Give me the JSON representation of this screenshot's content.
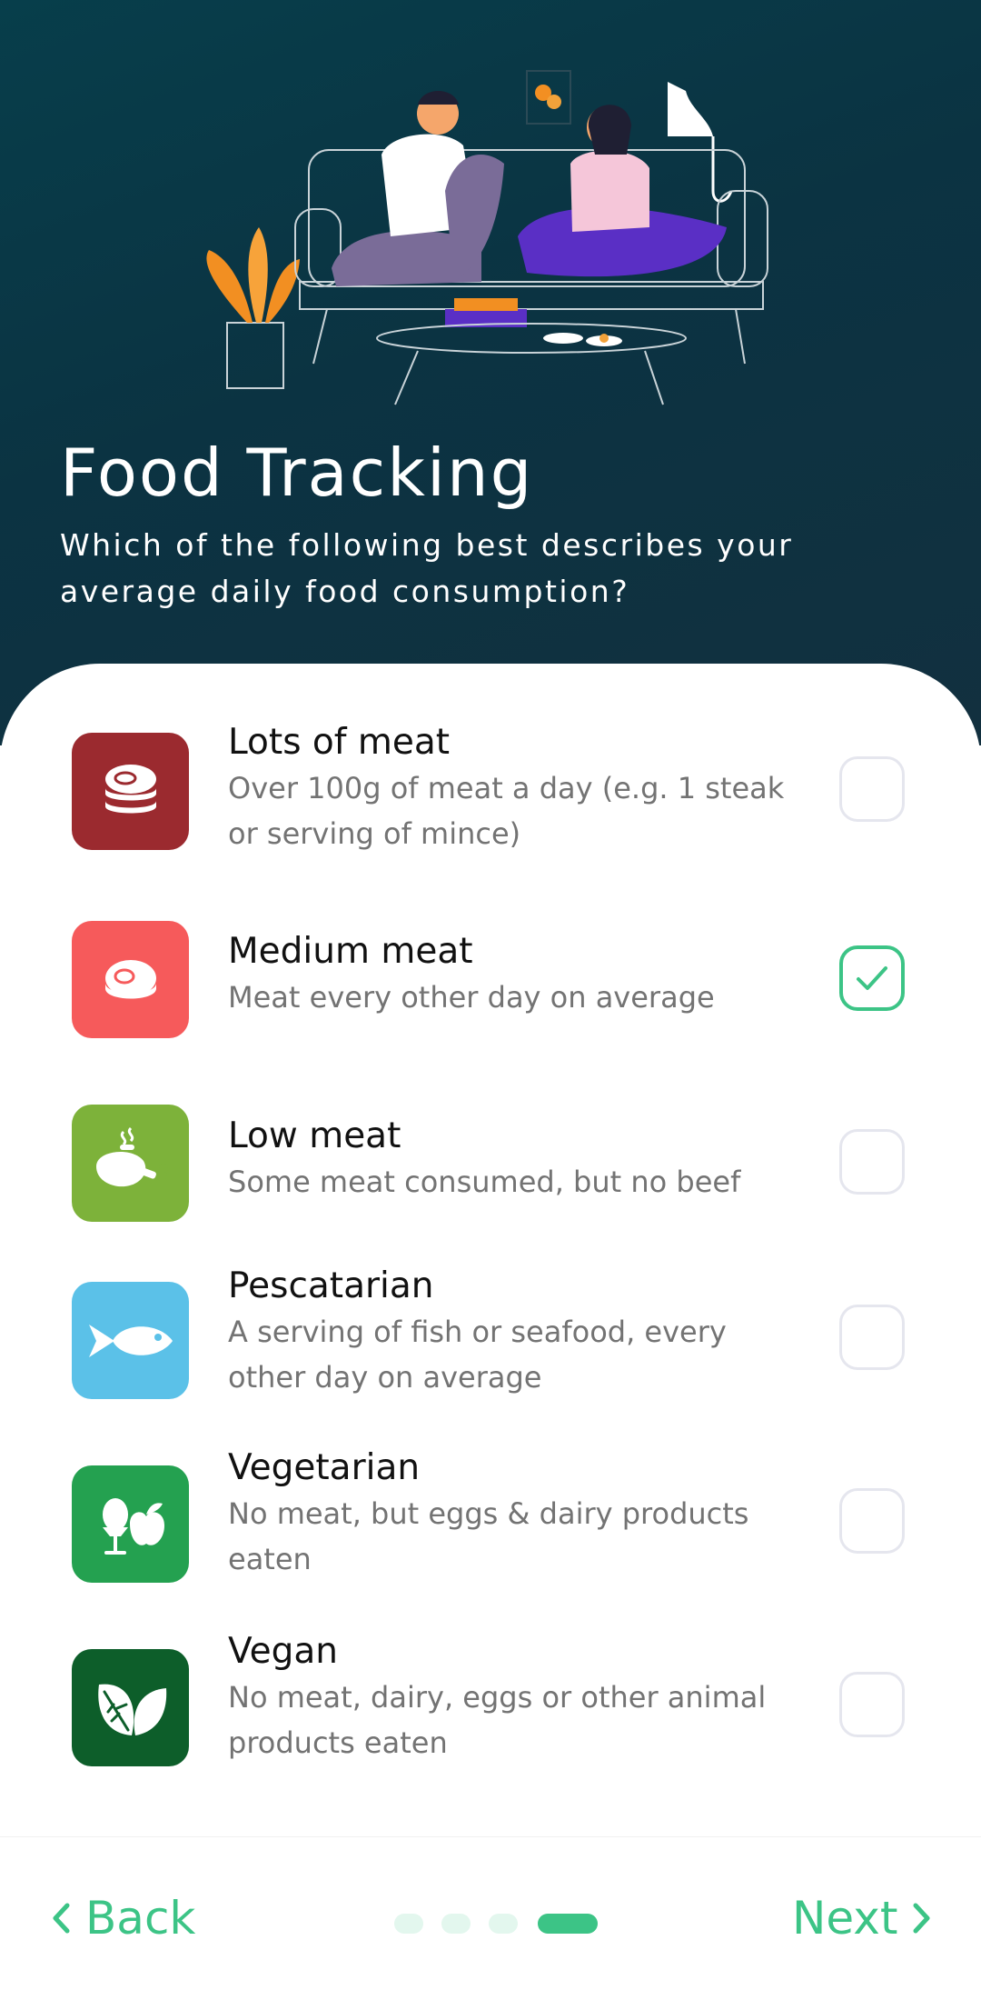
{
  "header": {
    "title": "Food Tracking",
    "subtitle": "Which of the following best describes your average daily food consumption?"
  },
  "options": [
    {
      "title": "Lots of meat",
      "desc": "Over 100g of meat a day (e.g. 1 steak or serving of mince)",
      "icon": "steak-stack-icon",
      "color": "#9b2a2f",
      "checked": false
    },
    {
      "title": "Medium meat",
      "desc": "Meat every other day on average",
      "icon": "steak-icon",
      "color": "#f65a5b",
      "checked": true
    },
    {
      "title": "Low meat",
      "desc": "Some meat consumed, but no beef",
      "icon": "chicken-icon",
      "color": "#7db23a",
      "checked": false
    },
    {
      "title": "Pescatarian",
      "desc": "A serving of fish or seafood, every other day on average",
      "icon": "fish-icon",
      "color": "#5bc1e8",
      "checked": false
    },
    {
      "title": "Vegetarian",
      "desc": "No meat, but eggs & dairy products eaten",
      "icon": "egg-apple-icon",
      "color": "#24a150",
      "checked": false
    },
    {
      "title": "Vegan",
      "desc": "No meat, dairy, eggs or other animal products eaten",
      "icon": "leaves-icon",
      "color": "#0d5e2a",
      "checked": false
    }
  ],
  "footer": {
    "back_label": "Back",
    "next_label": "Next",
    "pages_total": 4,
    "page_current": 4
  },
  "colors": {
    "accent": "#3cc486",
    "header_bg": "#0b3342"
  }
}
